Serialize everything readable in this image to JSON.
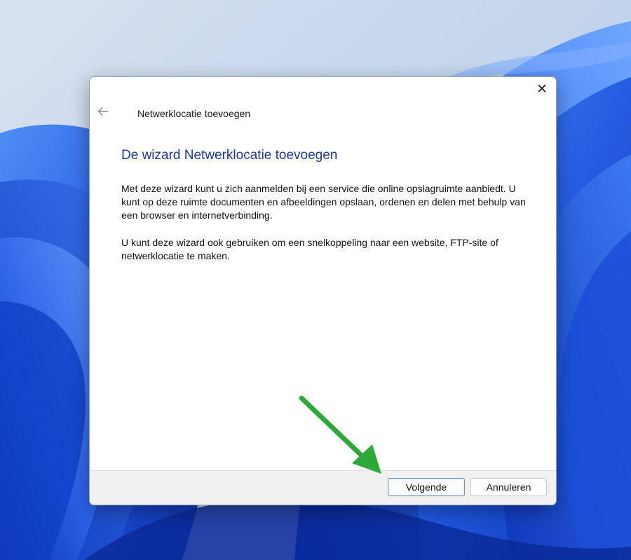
{
  "dialog": {
    "title": "Netwerklocatie toevoegen",
    "close_glyph": "✕",
    "heading": "De wizard Netwerklocatie toevoegen",
    "paragraph1": "Met deze wizard kunt u zich aanmelden bij een service die online opslagruimte aanbiedt. U kunt op deze ruimte documenten en afbeeldingen opslaan, ordenen en delen met behulp van een browser en internetverbinding.",
    "paragraph2": "U kunt deze wizard ook gebruiken om een snelkoppeling naar een website, FTP-site of netwerklocatie te maken.",
    "next_label": "Volgende",
    "cancel_label": "Annuleren"
  },
  "icons": {
    "back": "back-arrow-icon",
    "close": "close-icon",
    "annotation": "green-arrow-annotation"
  },
  "colors": {
    "heading": "#1f3a8c",
    "annotation_arrow": "#2fa83a",
    "wallpaper_blue": "#1f57e0"
  }
}
